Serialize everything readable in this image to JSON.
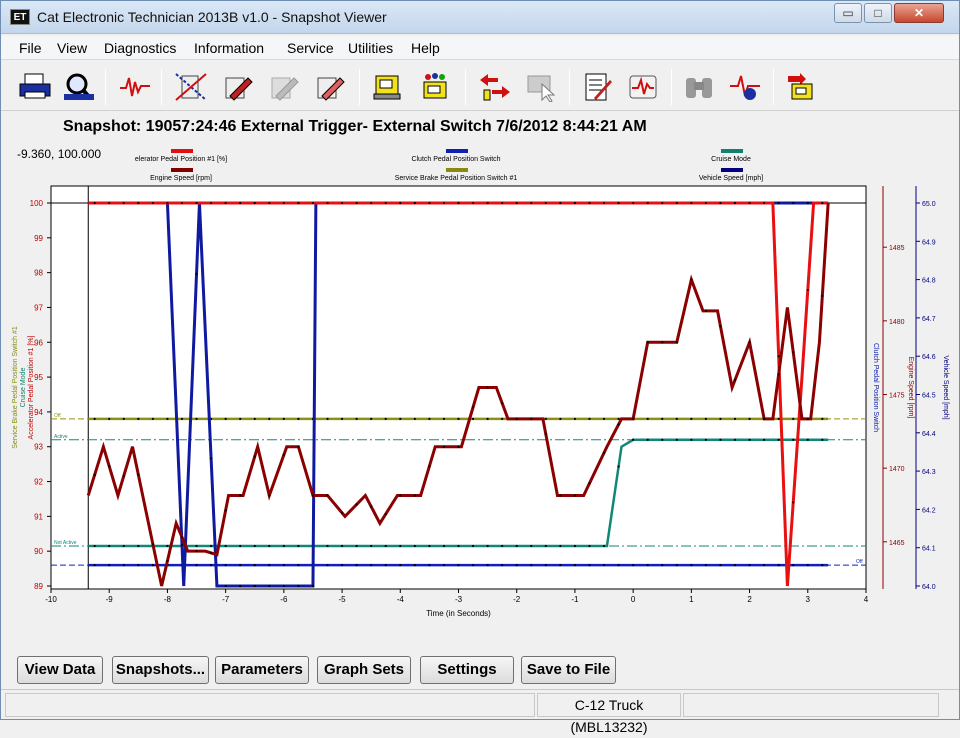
{
  "window": {
    "icon_text": "ET",
    "title": "Cat Electronic Technician 2013B v1.0 - Snapshot Viewer",
    "controls": {
      "minimize": "▭",
      "maximize": "□",
      "close": "✕"
    }
  },
  "menu": [
    "File",
    "View",
    "Diagnostics",
    "Information",
    "Service",
    "Utilities",
    "Help"
  ],
  "toolbar": {
    "icons": [
      "printer-icon",
      "print-preview-icon",
      "waveform-icon",
      "tool-disabled-icon",
      "tool-edit-icon",
      "tool-grey-icon",
      "tool-write-icon",
      "ecm-list-icon",
      "ecm-flash-icon",
      "arrows-exchange-icon",
      "ecm-cursor-icon",
      "report-icon",
      "heartbeat-icon",
      "binoculars-icon",
      "trigger-icon",
      "ecm-exit-icon"
    ]
  },
  "snapshot": {
    "title": "Snapshot: 19057:24:46 External Trigger- External Switch 7/6/2012 8:44:21 AM",
    "coordinate_readout": "-9.360, 100.000"
  },
  "chart_data": {
    "type": "line",
    "xlabel": "Time (in Seconds)",
    "xlim": [
      -10,
      4
    ],
    "x_ticks": [
      "-10",
      "-9",
      "-8",
      "-7",
      "-6",
      "-5",
      "-4",
      "-3",
      "-2",
      "-1",
      "0",
      "1",
      "2",
      "3",
      "4"
    ],
    "y_left_ticks": [
      "100",
      "99",
      "98",
      "97",
      "96",
      "95",
      "94",
      "93",
      "92",
      "91",
      "90",
      "89"
    ],
    "y_left_label": "Accelerator Pedal Position #1 [%]",
    "y_left_extra_labels": [
      "Service Brake Pedal Position Switch #1",
      "Cruise Mode"
    ],
    "ylim_left": [
      89,
      100
    ],
    "y_right1_label": "Clutch Pedal Position Switch",
    "y_right2_ticks": [
      "1485",
      "1480",
      "1475",
      "1470",
      "1465"
    ],
    "y_right2_label": "Engine Speed [rpm]",
    "y_right2_lim": [
      1462,
      1488
    ],
    "y_right3_ticks": [
      "65.0",
      "64.9",
      "64.8",
      "64.7",
      "64.6",
      "64.5",
      "64.4",
      "64.3",
      "64.2",
      "64.1",
      "64.0"
    ],
    "y_right3_label": "Vehicle Speed [mph]",
    "y_right3_lim": [
      64.0,
      65.0
    ],
    "legend": [
      {
        "name": "elerator Pedal Position #1 [%]",
        "color": "#e01010"
      },
      {
        "name": "Clutch Pedal Position Switch",
        "color": "#1020b0"
      },
      {
        "name": "Cruise Mode",
        "color": "#108070"
      },
      {
        "name": "Engine Speed [rpm]",
        "color": "#800000"
      },
      {
        "name": "Service Brake Pedal Position Switch #1",
        "color": "#8a8a10"
      },
      {
        "name": "Vehicle Speed [mph]",
        "color": "#000080"
      }
    ],
    "small_labels": {
      "service_brake": "Off",
      "cruise_on": "Active",
      "cruise_off": "Not Active",
      "vehicle_off": "Off"
    },
    "series": [
      {
        "name": "Accelerator Pedal Position #1 [%]",
        "color": "#e81010",
        "x": [
          -9.36,
          -5.5,
          2.4,
          2.65,
          2.9,
          3.1,
          3.35
        ],
        "y": [
          100,
          100,
          100,
          89,
          95,
          100,
          100
        ]
      },
      {
        "name": "Clutch Pedal Position Switch",
        "color": "#101aa0",
        "x": [
          -9.36,
          -8.0,
          -7.72,
          -7.45,
          -7.15,
          -5.5,
          -5.45,
          3.35
        ],
        "y": [
          100,
          100,
          89,
          100,
          89,
          89,
          100,
          100
        ]
      },
      {
        "name": "Vehicle Speed [mph]",
        "color": "#1020c0",
        "x": [
          -9.36,
          3.35
        ],
        "y": [
          89.6,
          89.6
        ]
      },
      {
        "name": "Engine Speed [rpm]",
        "color": "#8b0000",
        "x": [
          -9.36,
          -9.1,
          -8.85,
          -8.6,
          -8.35,
          -8.1,
          -7.85,
          -7.65,
          -7.35,
          -7.15,
          -6.95,
          -6.7,
          -6.45,
          -6.25,
          -5.95,
          -5.75,
          -5.5,
          -5.25,
          -4.95,
          -4.6,
          -4.35,
          -4.05,
          -3.85,
          -3.65,
          -3.4,
          -3.15,
          -2.95,
          -2.65,
          -2.35,
          -2.15,
          -1.85,
          -1.55,
          -1.3,
          -1.05,
          -0.85,
          -0.45,
          -0.2,
          0.0,
          0.25,
          0.45,
          0.75,
          1.0,
          1.2,
          1.45,
          1.7,
          2.0,
          2.25,
          2.4,
          2.65,
          2.9,
          3.05,
          3.2,
          3.35
        ],
        "y": [
          91.6,
          93.0,
          91.6,
          93.0,
          91.0,
          89.0,
          90.8,
          90.0,
          90.0,
          89.9,
          91.6,
          91.6,
          93.0,
          91.6,
          93.0,
          93.0,
          91.6,
          91.6,
          91.0,
          91.6,
          90.8,
          91.6,
          91.6,
          91.6,
          93.0,
          93.0,
          93.0,
          94.7,
          94.7,
          93.8,
          93.8,
          93.8,
          91.6,
          91.6,
          91.6,
          93.0,
          93.8,
          93.8,
          96.0,
          96.0,
          96.0,
          97.8,
          96.9,
          96.9,
          94.7,
          96.0,
          93.8,
          93.8,
          97.0,
          93.8,
          93.8,
          96.0,
          100
        ]
      },
      {
        "name": "Service Brake Pedal Position Switch #1",
        "color": "#909010",
        "x": [
          -9.36,
          3.35
        ],
        "y": [
          93.8,
          93.8
        ]
      },
      {
        "name": "Cruise Mode",
        "color": "#108878",
        "x": [
          -9.36,
          -0.45,
          -0.2,
          0.0,
          3.35
        ],
        "y": [
          90.15,
          90.15,
          93.0,
          93.2,
          93.2
        ]
      }
    ]
  },
  "buttons": [
    "View Data",
    "Snapshots...",
    "Parameters",
    "Graph Sets",
    "Settings",
    "Save to File"
  ],
  "status": {
    "left": "",
    "center": "C-12 Truck (MBL13232)",
    "right": ""
  }
}
